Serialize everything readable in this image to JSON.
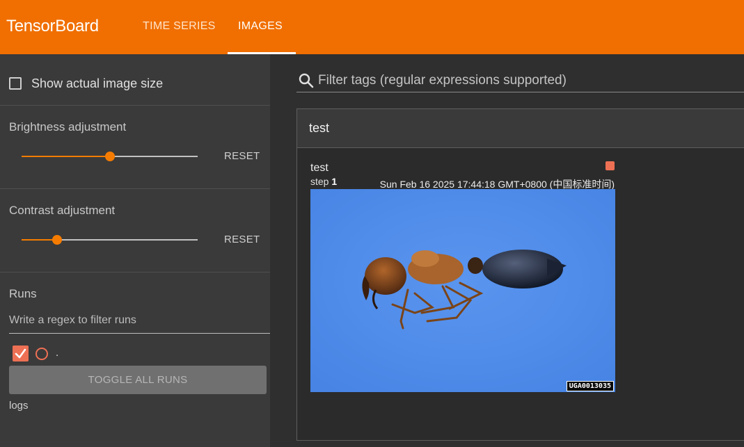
{
  "app": {
    "brand": "TensorBoard",
    "tabs": [
      {
        "label": "TIME SERIES",
        "active": false
      },
      {
        "label": "IMAGES",
        "active": true
      }
    ]
  },
  "sidebar": {
    "show_actual_size": {
      "label": "Show actual image size",
      "checked": false
    },
    "brightness": {
      "label": "Brightness adjustment",
      "value": 0.5,
      "reset_label": "RESET"
    },
    "contrast": {
      "label": "Contrast adjustment",
      "value": 0.2,
      "reset_label": "RESET"
    },
    "runs": {
      "title": "Runs",
      "filter_placeholder": "Write a regex to filter runs",
      "items": [
        {
          "name": ".",
          "checked": true,
          "color": "#ee7054"
        }
      ],
      "toggle_all_label": "TOGGLE ALL RUNS",
      "group_label": "logs"
    }
  },
  "main": {
    "filter_placeholder": "Filter tags (regular expressions supported)",
    "card": {
      "title": "test",
      "image": {
        "tag": "test",
        "step_label": "step",
        "step_value": "1",
        "timestamp": "Sun Feb 16 2025 17:44:18 GMT+0800 (中国标准时间)",
        "watermark": "UGA0013035"
      }
    }
  },
  "colors": {
    "accent": "#f06f00",
    "run": "#ee7054"
  }
}
